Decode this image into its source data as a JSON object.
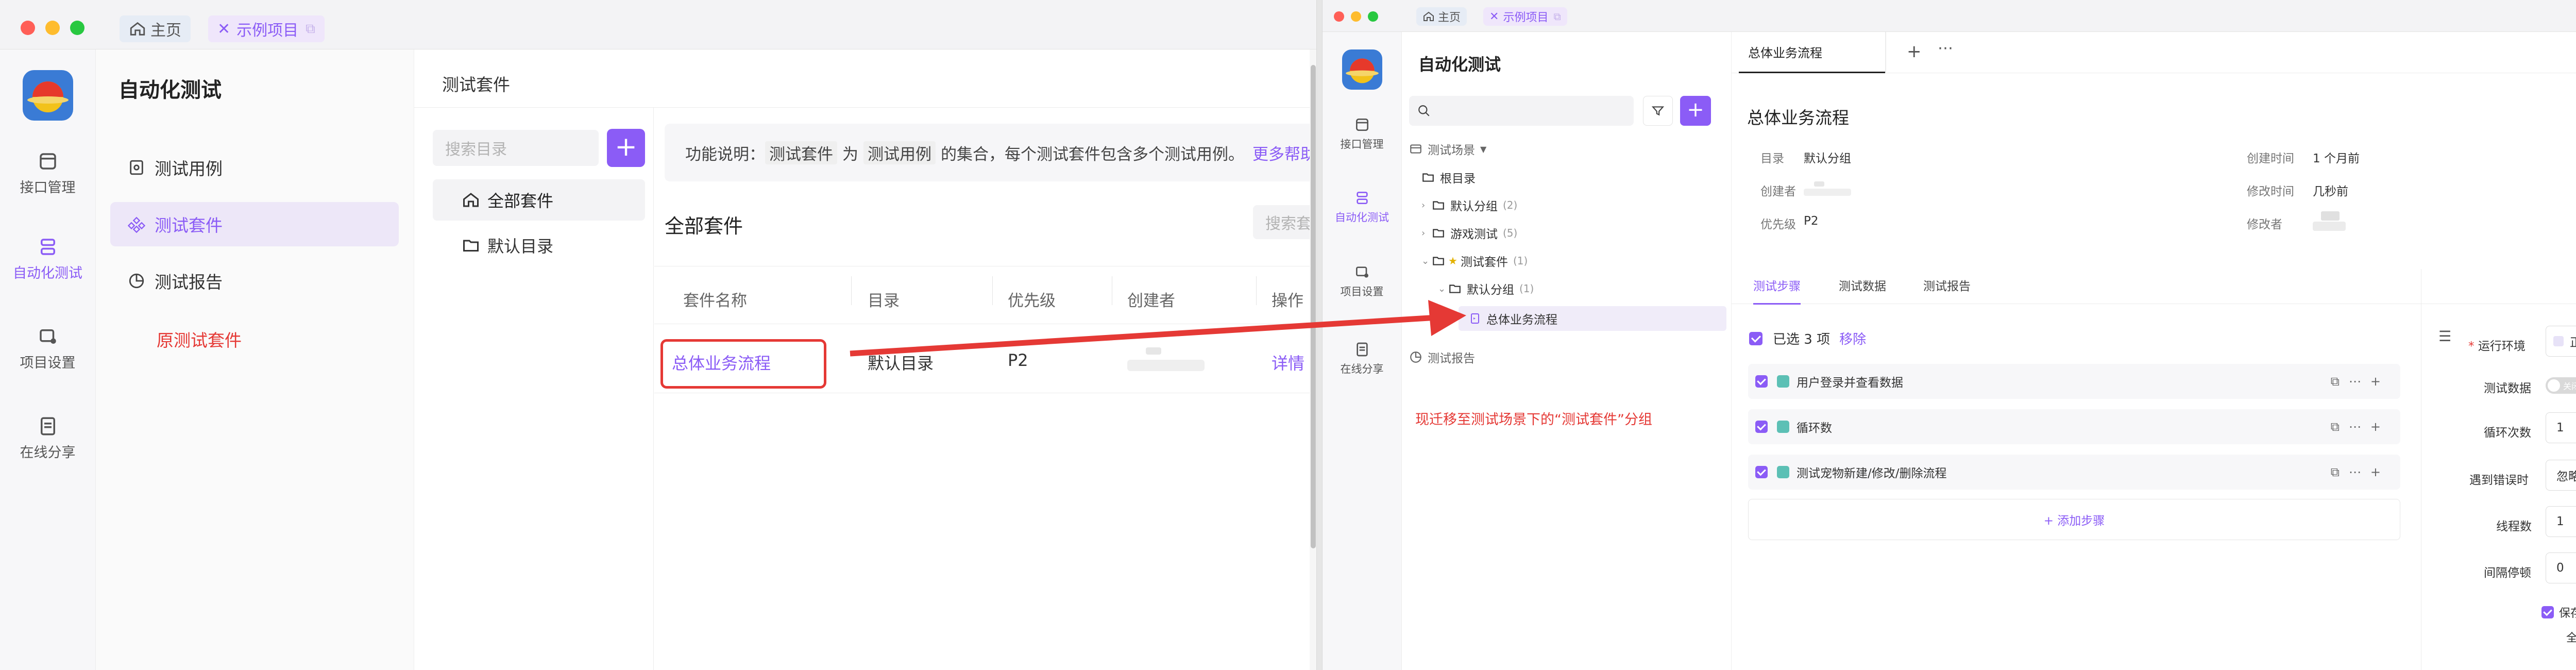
{
  "colors": {
    "accent": "#8b5cf6",
    "red": "#e53935",
    "tab_home_bg": "#e6ecf5",
    "tab_active_bg": "#efe6fb"
  },
  "left_window": {
    "tabs": {
      "home": "主页",
      "project": "示例项目"
    },
    "rail": [
      {
        "label": "接口管理",
        "icon": "api-icon"
      },
      {
        "label": "自动化测试",
        "icon": "automation-icon"
      },
      {
        "label": "项目设置",
        "icon": "settings-icon"
      },
      {
        "label": "在线分享",
        "icon": "share-icon"
      }
    ],
    "nav": {
      "title": "自动化测试",
      "items": [
        {
          "label": "测试用例",
          "icon": "test-case-icon"
        },
        {
          "label": "测试套件",
          "icon": "test-suite-icon"
        },
        {
          "label": "测试报告",
          "icon": "report-icon"
        }
      ],
      "annotation": "原测试套件"
    },
    "header": "测试套件",
    "search_placeholder": "搜索目录",
    "tree": [
      "全部套件",
      "默认目录"
    ],
    "info": {
      "prefix": "功能说明：",
      "chip1": "测试套件",
      "mid": "为",
      "chip2": "测试用例",
      "suffix": "的集合，每个测试套件包含多个测试用例。",
      "link": "更多帮助"
    },
    "section_title": "全部套件",
    "search2_placeholder": "搜索套件",
    "table": {
      "columns": [
        "套件名称",
        "目录",
        "优先级",
        "创建者",
        "操作"
      ],
      "rows": [
        {
          "name": "总体业务流程",
          "dir": "默认目录",
          "priority": "P2",
          "action": "详情"
        }
      ]
    }
  },
  "right_window": {
    "tabs": {
      "home": "主页",
      "project": "示例项目"
    },
    "rail": [
      {
        "label": "接口管理",
        "icon": "api-icon"
      },
      {
        "label": "自动化测试",
        "icon": "automation-icon"
      },
      {
        "label": "项目设置",
        "icon": "settings-icon"
      },
      {
        "label": "在线分享",
        "icon": "share-icon"
      }
    ],
    "nav": {
      "title": "自动化测试",
      "scene_label": "测试场景",
      "tree": [
        {
          "label": "根目录",
          "count": ""
        },
        {
          "label": "默认分组",
          "count": "(2)"
        },
        {
          "label": "游戏测试",
          "count": "(5)"
        },
        {
          "label": "测试套件",
          "count": "(1)"
        },
        {
          "label": "默认分组",
          "count": "(1)"
        },
        {
          "label": "总体业务流程",
          "count": ""
        }
      ],
      "report_label": "测试报告",
      "annotation": "现迁移至测试场景下的“测试套件”分组"
    },
    "doc_tab": "总体业务流程",
    "title": "总体业务流程",
    "meta": {
      "dir_label": "目录",
      "dir_value": "默认分组",
      "creator_label": "创建者",
      "priority_label": "优先级",
      "priority_value": "P2",
      "created_label": "创建时间",
      "created_value": "1 个月前",
      "modified_label": "修改时间",
      "modified_value": "几秒前",
      "modifier_label": "修改者"
    },
    "subtabs": [
      "测试步骤",
      "测试数据",
      "测试报告"
    ],
    "selected": {
      "text": "已选 3 项",
      "action": "移除"
    },
    "steps": [
      "用户登录并查看数据",
      "循环数",
      "测试宠物新建/修改/删除流程"
    ],
    "add_step": "+ 添加步骤",
    "settings": {
      "env_label": "运行环境",
      "env_value": "正式环境",
      "data_label": "测试数据",
      "data_toggle": "关闭",
      "loops_label": "循环次数",
      "loops_value": "1",
      "error_label": "遇到错误时",
      "error_value": "忽略",
      "threads_label": "线程数",
      "threads_value": "1",
      "interval_label": "间隔停顿",
      "interval_value": "0",
      "save_label": "保存请求/响应",
      "all_label": "全部请求"
    }
  }
}
